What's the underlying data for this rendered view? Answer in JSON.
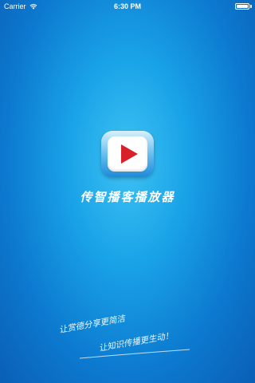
{
  "status_bar": {
    "carrier": "Carrier",
    "time": "6:30 PM",
    "battery_level": 1.0
  },
  "splash": {
    "app_name": "传智播客播放器",
    "slogan_line1": "让赏德分享更简洁",
    "slogan_line2": "让知识传播更生动！"
  },
  "colors": {
    "background": "#1aa4e8",
    "play_triangle": "#d8202a",
    "text": "#ffffff"
  },
  "icons": {
    "app": "play-icon",
    "wifi": "wifi-icon",
    "battery": "battery-icon"
  }
}
